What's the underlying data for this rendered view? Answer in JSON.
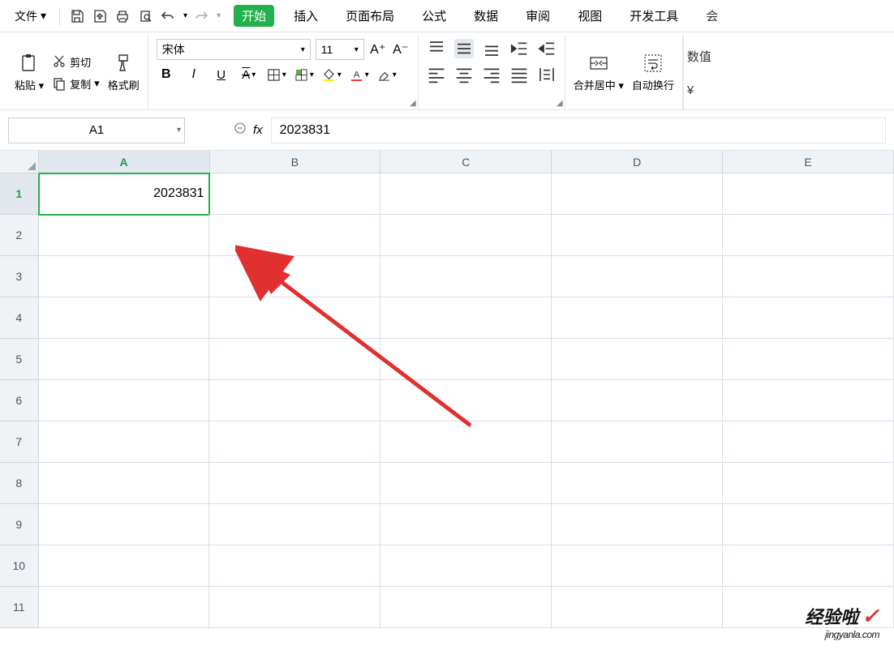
{
  "menubar": {
    "file_label": "文件",
    "tabs": [
      "开始",
      "插入",
      "页面布局",
      "公式",
      "数据",
      "审阅",
      "视图",
      "开发工具"
    ],
    "tab_clipped": "会"
  },
  "ribbon": {
    "paste": "粘贴",
    "cut": "剪切",
    "copy": "复制",
    "format_painter": "格式刷",
    "font_name": "宋体",
    "font_size": "11",
    "bold": "B",
    "italic": "I",
    "underline": "U",
    "font_bigger": "A⁺",
    "font_smaller": "A⁻",
    "merge_center": "合并居中",
    "wrap_text": "自动换行",
    "number_label": "数值",
    "currency_symbol": "¥"
  },
  "formula": {
    "namebox": "A1",
    "fx": "fx",
    "value": "2023831"
  },
  "sheet": {
    "columns": [
      "A",
      "B",
      "C",
      "D",
      "E"
    ],
    "rows": [
      "1",
      "2",
      "3",
      "4",
      "5",
      "6",
      "7",
      "8",
      "9",
      "10",
      "11"
    ],
    "cells": {
      "A1": "2023831"
    }
  },
  "watermark": {
    "line1": "经验啦",
    "line2": "jingyanla.com"
  }
}
